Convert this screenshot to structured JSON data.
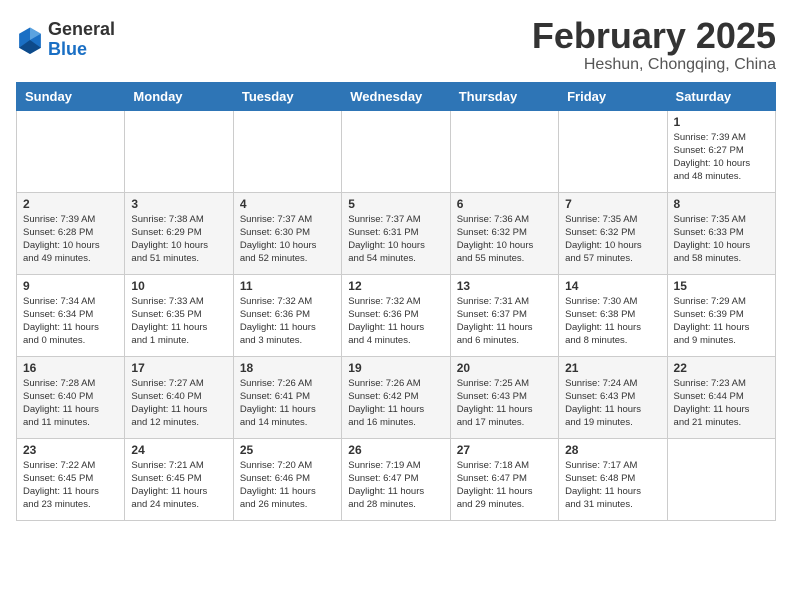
{
  "header": {
    "logo": {
      "line1": "General",
      "line2": "Blue"
    },
    "title": "February 2025",
    "subtitle": "Heshun, Chongqing, China"
  },
  "weekdays": [
    "Sunday",
    "Monday",
    "Tuesday",
    "Wednesday",
    "Thursday",
    "Friday",
    "Saturday"
  ],
  "weeks": [
    [
      {
        "day": "",
        "info": ""
      },
      {
        "day": "",
        "info": ""
      },
      {
        "day": "",
        "info": ""
      },
      {
        "day": "",
        "info": ""
      },
      {
        "day": "",
        "info": ""
      },
      {
        "day": "",
        "info": ""
      },
      {
        "day": "1",
        "info": "Sunrise: 7:39 AM\nSunset: 6:27 PM\nDaylight: 10 hours\nand 48 minutes."
      }
    ],
    [
      {
        "day": "2",
        "info": "Sunrise: 7:39 AM\nSunset: 6:28 PM\nDaylight: 10 hours\nand 49 minutes."
      },
      {
        "day": "3",
        "info": "Sunrise: 7:38 AM\nSunset: 6:29 PM\nDaylight: 10 hours\nand 51 minutes."
      },
      {
        "day": "4",
        "info": "Sunrise: 7:37 AM\nSunset: 6:30 PM\nDaylight: 10 hours\nand 52 minutes."
      },
      {
        "day": "5",
        "info": "Sunrise: 7:37 AM\nSunset: 6:31 PM\nDaylight: 10 hours\nand 54 minutes."
      },
      {
        "day": "6",
        "info": "Sunrise: 7:36 AM\nSunset: 6:32 PM\nDaylight: 10 hours\nand 55 minutes."
      },
      {
        "day": "7",
        "info": "Sunrise: 7:35 AM\nSunset: 6:32 PM\nDaylight: 10 hours\nand 57 minutes."
      },
      {
        "day": "8",
        "info": "Sunrise: 7:35 AM\nSunset: 6:33 PM\nDaylight: 10 hours\nand 58 minutes."
      }
    ],
    [
      {
        "day": "9",
        "info": "Sunrise: 7:34 AM\nSunset: 6:34 PM\nDaylight: 11 hours\nand 0 minutes."
      },
      {
        "day": "10",
        "info": "Sunrise: 7:33 AM\nSunset: 6:35 PM\nDaylight: 11 hours\nand 1 minute."
      },
      {
        "day": "11",
        "info": "Sunrise: 7:32 AM\nSunset: 6:36 PM\nDaylight: 11 hours\nand 3 minutes."
      },
      {
        "day": "12",
        "info": "Sunrise: 7:32 AM\nSunset: 6:36 PM\nDaylight: 11 hours\nand 4 minutes."
      },
      {
        "day": "13",
        "info": "Sunrise: 7:31 AM\nSunset: 6:37 PM\nDaylight: 11 hours\nand 6 minutes."
      },
      {
        "day": "14",
        "info": "Sunrise: 7:30 AM\nSunset: 6:38 PM\nDaylight: 11 hours\nand 8 minutes."
      },
      {
        "day": "15",
        "info": "Sunrise: 7:29 AM\nSunset: 6:39 PM\nDaylight: 11 hours\nand 9 minutes."
      }
    ],
    [
      {
        "day": "16",
        "info": "Sunrise: 7:28 AM\nSunset: 6:40 PM\nDaylight: 11 hours\nand 11 minutes."
      },
      {
        "day": "17",
        "info": "Sunrise: 7:27 AM\nSunset: 6:40 PM\nDaylight: 11 hours\nand 12 minutes."
      },
      {
        "day": "18",
        "info": "Sunrise: 7:26 AM\nSunset: 6:41 PM\nDaylight: 11 hours\nand 14 minutes."
      },
      {
        "day": "19",
        "info": "Sunrise: 7:26 AM\nSunset: 6:42 PM\nDaylight: 11 hours\nand 16 minutes."
      },
      {
        "day": "20",
        "info": "Sunrise: 7:25 AM\nSunset: 6:43 PM\nDaylight: 11 hours\nand 17 minutes."
      },
      {
        "day": "21",
        "info": "Sunrise: 7:24 AM\nSunset: 6:43 PM\nDaylight: 11 hours\nand 19 minutes."
      },
      {
        "day": "22",
        "info": "Sunrise: 7:23 AM\nSunset: 6:44 PM\nDaylight: 11 hours\nand 21 minutes."
      }
    ],
    [
      {
        "day": "23",
        "info": "Sunrise: 7:22 AM\nSunset: 6:45 PM\nDaylight: 11 hours\nand 23 minutes."
      },
      {
        "day": "24",
        "info": "Sunrise: 7:21 AM\nSunset: 6:45 PM\nDaylight: 11 hours\nand 24 minutes."
      },
      {
        "day": "25",
        "info": "Sunrise: 7:20 AM\nSunset: 6:46 PM\nDaylight: 11 hours\nand 26 minutes."
      },
      {
        "day": "26",
        "info": "Sunrise: 7:19 AM\nSunset: 6:47 PM\nDaylight: 11 hours\nand 28 minutes."
      },
      {
        "day": "27",
        "info": "Sunrise: 7:18 AM\nSunset: 6:47 PM\nDaylight: 11 hours\nand 29 minutes."
      },
      {
        "day": "28",
        "info": "Sunrise: 7:17 AM\nSunset: 6:48 PM\nDaylight: 11 hours\nand 31 minutes."
      },
      {
        "day": "",
        "info": ""
      }
    ]
  ]
}
